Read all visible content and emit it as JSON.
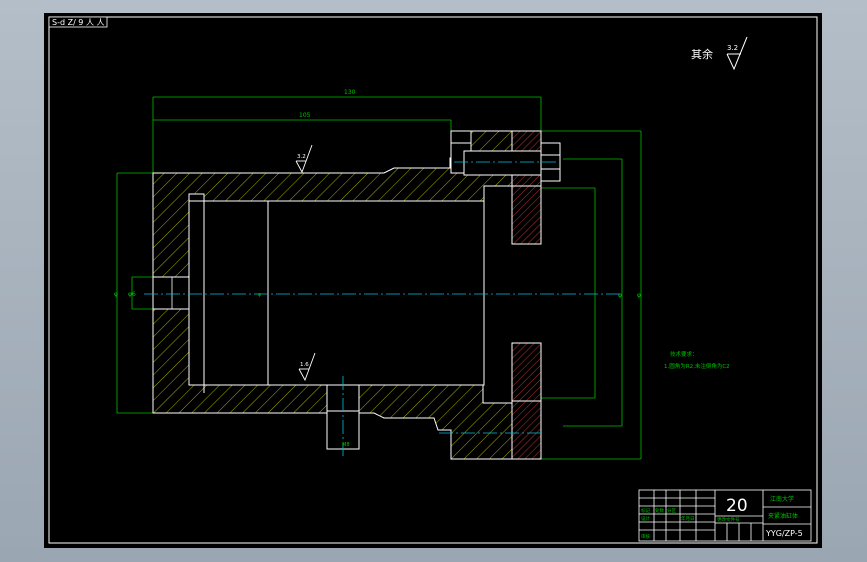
{
  "drawing": {
    "tab_title": "S-d Z/ 9 人 人",
    "surface_finish_rest_label": "其余",
    "surface_finish_rest_value": "3.2",
    "roughness_top_value": "3.2",
    "roughness_bottom_value": "1.6",
    "dim_overall_length": "130",
    "dim_inner_length": "105",
    "dim_left_hole": "φ6",
    "dim_port": "M8",
    "dim_bore": "φ",
    "dim_outer": "φ",
    "dim_right": "φ",
    "tech_req_title": "技术要求：",
    "tech_req_line1": "1.圆角为R2,未注倒角为C2",
    "title_block": {
      "scale": "20",
      "school": "江南大学",
      "part_name": "夹紧油缸体",
      "drawing_no": "YYG/ZP-5",
      "cell_labels": [
        "标记",
        "处数",
        "分区",
        "更改文件号",
        "签名",
        "年月日",
        "设计",
        "审核",
        "工艺",
        "批准"
      ]
    }
  }
}
